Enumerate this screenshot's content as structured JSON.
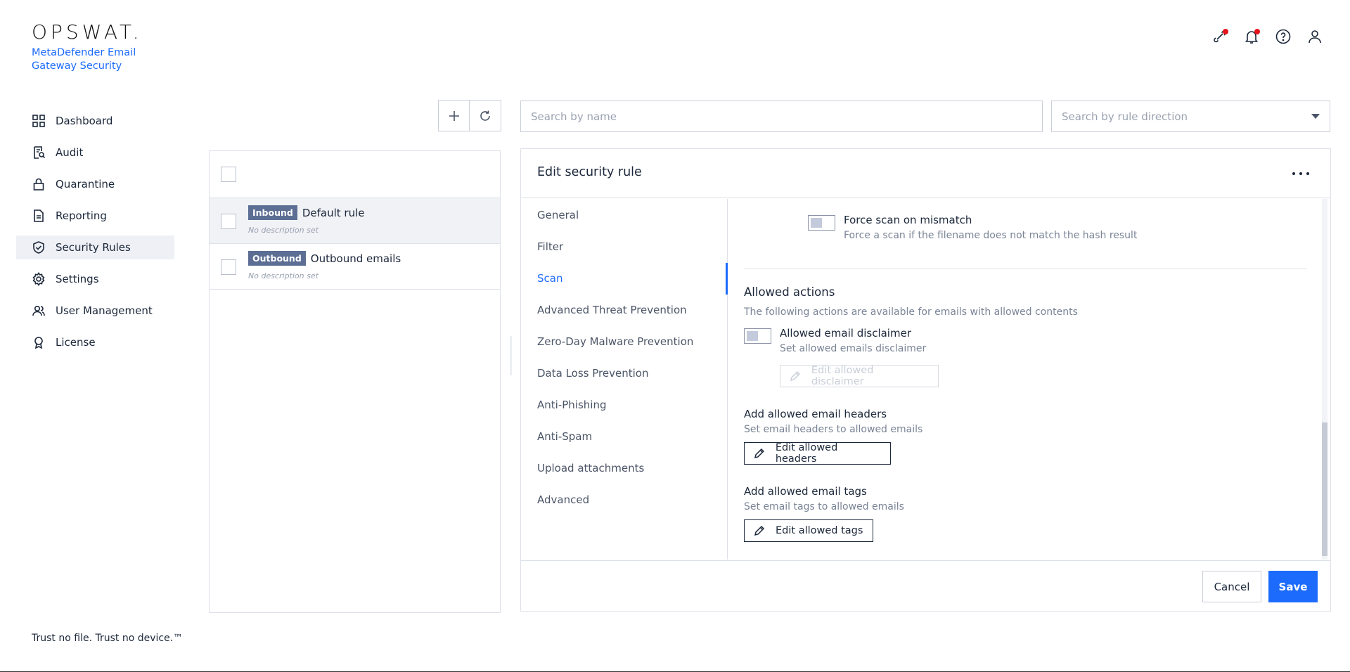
{
  "brand": {
    "logo": "OPSWAT.",
    "product": "MetaDefender Email Gateway Security",
    "tagline": "Trust no file. Trust no device.™"
  },
  "sidebar": {
    "items": [
      {
        "label": "Dashboard",
        "icon": "dashboard-icon"
      },
      {
        "label": "Audit",
        "icon": "audit-icon"
      },
      {
        "label": "Quarantine",
        "icon": "lock-icon"
      },
      {
        "label": "Reporting",
        "icon": "document-icon"
      },
      {
        "label": "Security Rules",
        "icon": "shield-check-icon",
        "active": true
      },
      {
        "label": "Settings",
        "icon": "gear-icon"
      },
      {
        "label": "User Management",
        "icon": "users-icon"
      },
      {
        "label": "License",
        "icon": "award-icon"
      }
    ]
  },
  "header_icons": [
    "integration-icon",
    "bell-icon",
    "help-icon",
    "user-icon"
  ],
  "search": {
    "name_placeholder": "Search by name",
    "direction_placeholder": "Search by rule direction"
  },
  "rules": [
    {
      "badge": "Inbound",
      "name": "Default rule",
      "description": "No description set",
      "selected": true
    },
    {
      "badge": "Outbound",
      "name": "Outbound emails",
      "description": "No description set",
      "selected": false
    }
  ],
  "edit": {
    "title": "Edit security rule",
    "tabs": [
      "General",
      "Filter",
      "Scan",
      "Advanced Threat Prevention",
      "Zero-Day Malware Prevention",
      "Data Loss Prevention",
      "Anti-Phishing",
      "Anti-Spam",
      "Upload attachments",
      "Advanced"
    ],
    "active_tab": "Scan",
    "force_scan": {
      "label": "Force scan on mismatch",
      "description": "Force a scan if the filename does not match the hash result"
    },
    "allowed_actions": {
      "title": "Allowed actions",
      "description": "The following actions are available for emails with allowed contents",
      "disclaimer_label": "Allowed email disclaimer",
      "disclaimer_description": "Set allowed emails disclaimer",
      "disclaimer_button": "Edit allowed disclaimer",
      "headers_label": "Add allowed email headers",
      "headers_description": "Set email headers to allowed emails",
      "headers_button": "Edit allowed headers",
      "tags_label": "Add allowed email tags",
      "tags_description": "Set email tags to allowed emails",
      "tags_button": "Edit allowed tags"
    },
    "cancel_label": "Cancel",
    "save_label": "Save"
  },
  "colors": {
    "accent": "#1d6bfc",
    "badge": "#5c6e94",
    "notification": "#e5131d"
  }
}
